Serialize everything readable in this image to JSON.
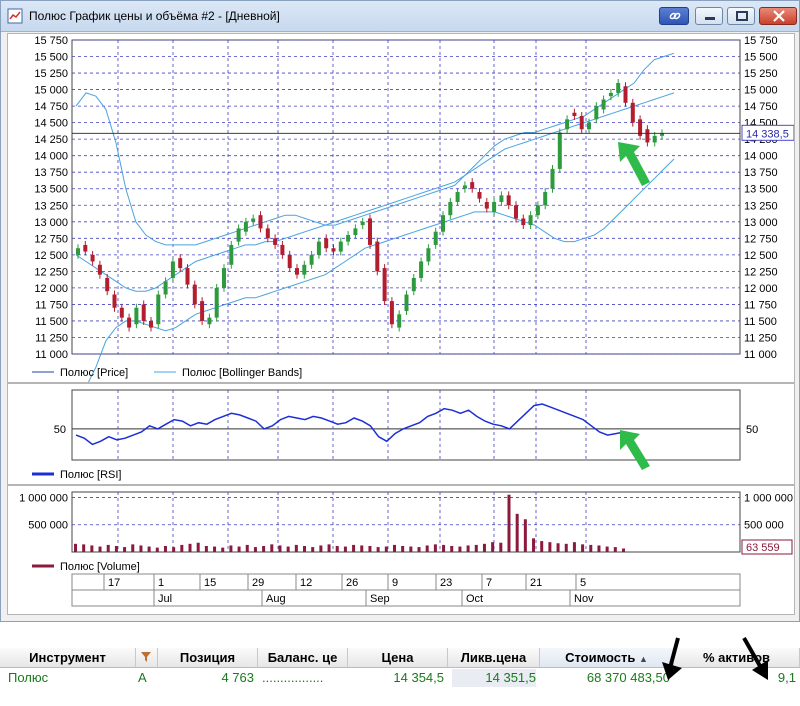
{
  "window": {
    "title": "Полюс График цены и объёма #2 - [Дневной]"
  },
  "price_panel": {
    "y_ticks": [
      "15 750",
      "15 500",
      "15 250",
      "15 000",
      "14 750",
      "14 500",
      "14 250",
      "14 000",
      "13 750",
      "13 500",
      "13 250",
      "13 000",
      "12 750",
      "12 500",
      "12 250",
      "12 000",
      "11 750",
      "11 500",
      "11 250",
      "11 000"
    ],
    "last_price_label": "14 338,5",
    "legend": [
      {
        "label": "Полюс [Price]",
        "color": "#1f3f9f"
      },
      {
        "label": "Полюс [Bollinger Bands]",
        "color": "#4aa3e0"
      }
    ]
  },
  "rsi_panel": {
    "level_label": "50",
    "legend_label": "Полюс [RSI]",
    "color": "#1c2fd6"
  },
  "volume_panel": {
    "y_ticks": [
      "1 000 000",
      "500 000"
    ],
    "last_volume_label": "63 559",
    "legend_label": "Полюс [Volume]",
    "color": "#8b1a3c"
  },
  "time_axis": {
    "days": [
      "17",
      "1",
      "15",
      "29",
      "12",
      "26",
      "9",
      "23",
      "7",
      "21",
      "5"
    ],
    "months": [
      "Jul",
      "Aug",
      "Sep",
      "Oct",
      "Nov"
    ]
  },
  "colors": {
    "up_candle": "#2e9a3e",
    "down_candle": "#b21e2e",
    "grid": "#4040c0",
    "arrow_green": "#2ebb4a",
    "positive_text": "#1a7a1a"
  },
  "portfolio_table": {
    "columns": [
      "Инструмент",
      "",
      "Позиция",
      "Баланс. це",
      "Цена",
      "Ликв.цена",
      "Стоимость",
      "% активов"
    ],
    "sorted_column": "Стоимость",
    "row": {
      "instrument": "Полюс",
      "type": "А",
      "position": "4 763",
      "balance_price": ".................",
      "price": "14 354,5",
      "liq_price": "14 351,5",
      "value": "68 370 483,50",
      "pct_assets": "9,1"
    }
  },
  "chart_data": {
    "type": "line",
    "title": "Полюс График цены и объёма #2 - [Дневной]",
    "xlabel": "",
    "ylabel": "",
    "x_tick_labels": [
      "17",
      "1",
      "15",
      "29",
      "12",
      "26",
      "9",
      "23",
      "7",
      "21",
      "5"
    ],
    "x_month_labels": [
      "Jul",
      "Aug",
      "Sep",
      "Oct",
      "Nov"
    ],
    "ylim": [
      11000,
      15750
    ],
    "grid": true,
    "legend_position": "bottom-left",
    "series": [
      {
        "name": "Полюс [Price]",
        "kind": "candlestick",
        "close": [
          12600,
          12550,
          12400,
          12200,
          11950,
          11700,
          11550,
          11400,
          11700,
          11500,
          11400,
          11900,
          12100,
          12400,
          12300,
          12050,
          11750,
          11500,
          11550,
          12000,
          12300,
          12650,
          12900,
          13000,
          13050,
          12900,
          12750,
          12650,
          12500,
          12300,
          12200,
          12350,
          12500,
          12700,
          12600,
          12550,
          12700,
          12800,
          12900,
          13000,
          12650,
          12250,
          11800,
          11450,
          11600,
          11900,
          12150,
          12400,
          12600,
          12850,
          13100,
          13300,
          13450,
          13550,
          13500,
          13350,
          13200,
          13300,
          13400,
          13250,
          13050,
          12950,
          13100,
          13250,
          13450,
          13800,
          14350,
          14550,
          14600,
          14400,
          14500,
          14750,
          14850,
          14950,
          15100,
          14800,
          14500,
          14300,
          14200,
          14300,
          14338.5
        ],
        "open": [
          12500,
          12650,
          12500,
          12350,
          12150,
          11900,
          11700,
          11550,
          11450,
          11750,
          11500,
          11450,
          11900,
          12150,
          12450,
          12300,
          12050,
          11800,
          11450,
          11550,
          12000,
          12350,
          12700,
          12850,
          13000,
          13100,
          12900,
          12750,
          12650,
          12500,
          12300,
          12200,
          12350,
          12500,
          12750,
          12600,
          12550,
          12700,
          12800,
          12950,
          13050,
          12700,
          12300,
          11800,
          11400,
          11650,
          11950,
          12150,
          12400,
          12650,
          12850,
          13100,
          13300,
          13500,
          13600,
          13450,
          13300,
          13150,
          13300,
          13400,
          13250,
          13050,
          12950,
          13100,
          13250,
          13500,
          13800,
          14400,
          14650,
          14600,
          14400,
          14550,
          14700,
          14900,
          14950,
          15050,
          14800,
          14550,
          14400,
          14200,
          14300
        ]
      },
      {
        "name": "Полюс [Bollinger Bands]",
        "upper": [
          14750,
          14950,
          14900,
          14700,
          14200,
          13500,
          13000,
          12800,
          12700,
          12650,
          12650,
          12650,
          12650,
          12700,
          12750,
          12800,
          12850,
          12900,
          12950,
          13000,
          13050,
          13100,
          13100,
          13050,
          13000,
          12950,
          12950,
          13000,
          13050,
          13100,
          13150,
          13200,
          13250,
          13300,
          13350,
          13400,
          13450,
          13500,
          13550,
          13700,
          13850,
          14000,
          14150,
          14250,
          14300,
          14350,
          14350,
          14400,
          14450,
          14500,
          14550,
          14600,
          14700,
          14800,
          14900,
          15000,
          15100,
          15300,
          15450,
          15500,
          15550
        ],
        "middle": [
          12500,
          12400,
          12300,
          12200,
          12100,
          12000,
          11950,
          11950,
          12000,
          12100,
          12200,
          12300,
          12400,
          12450,
          12500,
          12550,
          12600,
          12650,
          12650,
          12700,
          12700,
          12750,
          12800,
          12850,
          12900,
          12950,
          13000,
          13050,
          13100,
          13150,
          13200,
          13250,
          13300,
          13350,
          13400,
          13450,
          13500,
          13550,
          13600,
          13700,
          13800,
          13900,
          14000,
          14100,
          14150,
          14200,
          14250,
          14300,
          14350,
          14400,
          14450,
          14500,
          14550,
          14600,
          14650,
          14700,
          14750,
          14800,
          14850,
          14900,
          14950
        ],
        "lower": [
          10300,
          10500,
          10800,
          11200,
          11400,
          11500,
          11500,
          11450,
          11400,
          11350,
          11400,
          11500,
          11600,
          11650,
          11700,
          11750,
          11800,
          11850,
          11850,
          11900,
          11950,
          12000,
          12050,
          12100,
          12150,
          12200,
          12300,
          12400,
          12500,
          12600,
          12650,
          12700,
          12750,
          12800,
          12850,
          12900,
          12950,
          13000,
          13050,
          13100,
          13150,
          13150,
          13150,
          13100,
          13050,
          13000,
          12950,
          12850,
          12750,
          12700,
          12700,
          12750,
          12800,
          12900,
          13050,
          13200,
          13350,
          13500,
          13650,
          13800,
          13950
        ]
      },
      {
        "name": "Полюс [RSI]",
        "level": 50,
        "values": [
          46,
          44,
          40,
          42,
          45,
          43,
          44,
          46,
          48,
          52,
          50,
          53,
          56,
          55,
          52,
          54,
          53,
          56,
          58,
          60,
          59,
          57,
          55,
          50,
          52,
          56,
          58,
          57,
          56,
          58,
          57,
          55,
          53,
          54,
          57,
          55,
          52,
          45,
          42,
          47,
          50,
          52,
          54,
          58,
          60,
          63,
          62,
          60,
          62,
          58,
          55,
          53,
          52,
          50,
          55,
          60,
          65,
          66,
          64,
          62,
          60,
          58,
          56,
          52,
          48,
          46,
          47,
          48
        ]
      },
      {
        "name": "Полюс [Volume]",
        "values": [
          150000,
          140000,
          120000,
          100000,
          130000,
          110000,
          90000,
          140000,
          120000,
          100000,
          80000,
          110000,
          90000,
          130000,
          150000,
          170000,
          110000,
          100000,
          80000,
          120000,
          100000,
          130000,
          90000,
          110000,
          140000,
          120000,
          100000,
          130000,
          110000,
          90000,
          120000,
          140000,
          110000,
          100000,
          130000,
          120000,
          110000,
          90000,
          100000,
          130000,
          110000,
          100000,
          90000,
          120000,
          140000,
          130000,
          110000,
          100000,
          120000,
          130000,
          150000,
          180000,
          170000,
          1050000,
          700000,
          600000,
          250000,
          200000,
          180000,
          160000,
          150000,
          180000,
          140000,
          130000,
          120000,
          100000,
          90000,
          63559
        ]
      }
    ]
  }
}
